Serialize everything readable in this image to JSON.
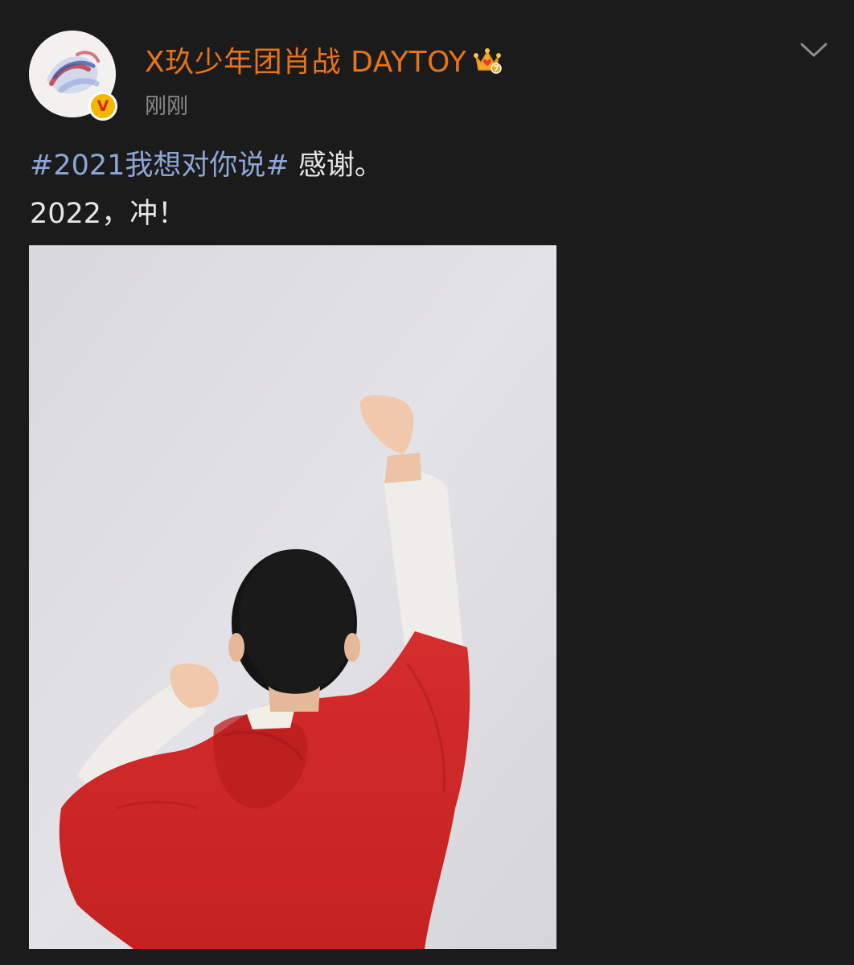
{
  "post": {
    "username": "X玖少年团肖战 DAYTOY",
    "timestamp": "刚刚",
    "verified_badge": "V",
    "content": {
      "topic": "#2021我想对你说#",
      "line1_rest": " 感谢。",
      "line2": "2022，冲！"
    }
  },
  "icons": {
    "avatar": "avatar-image",
    "badge": "verified-icon",
    "crown": "crown-member-icon",
    "more": "chevron-down-icon"
  },
  "colors": {
    "background": "#1b1b1b",
    "username": "#e8731a",
    "topic": "#8ea6d6",
    "text": "#e6e6e6",
    "timestamp": "#8a8a8a"
  }
}
